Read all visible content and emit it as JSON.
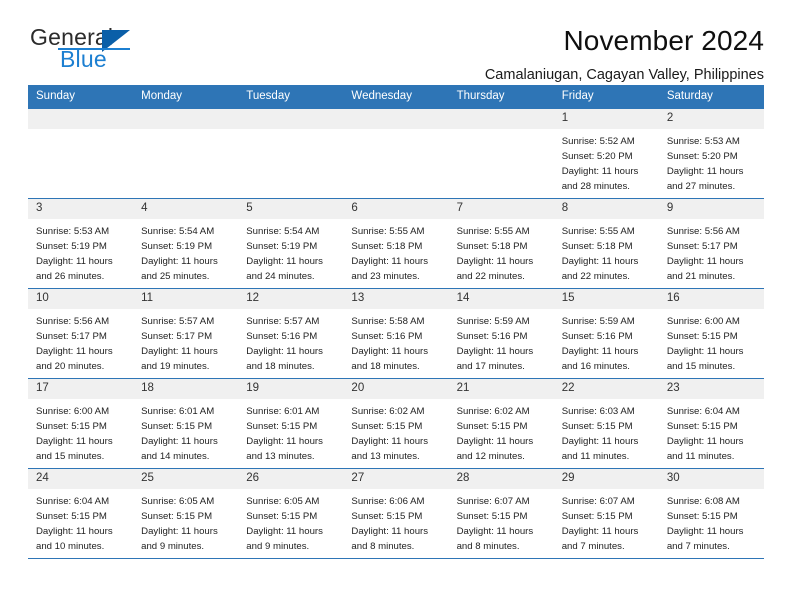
{
  "logo": {
    "word_top": "General",
    "word_bottom": "Blue",
    "triangle_icon": "blue-triangle-icon",
    "accent_dark": "#0a5fa8",
    "accent_light": "#1c7fd1"
  },
  "header": {
    "title": "November 2024",
    "location": "Camalaniugan, Cagayan Valley, Philippines"
  },
  "theme": {
    "header_blue": "#2e75b6",
    "daynum_gray": "#f0f0f0"
  },
  "weekdays": [
    "Sunday",
    "Monday",
    "Tuesday",
    "Wednesday",
    "Thursday",
    "Friday",
    "Saturday"
  ],
  "weeks": [
    [
      {
        "day": "",
        "lines": []
      },
      {
        "day": "",
        "lines": []
      },
      {
        "day": "",
        "lines": []
      },
      {
        "day": "",
        "lines": []
      },
      {
        "day": "",
        "lines": []
      },
      {
        "day": "1",
        "lines": [
          "Sunrise: 5:52 AM",
          "Sunset: 5:20 PM",
          "Daylight: 11 hours",
          "and 28 minutes."
        ]
      },
      {
        "day": "2",
        "lines": [
          "Sunrise: 5:53 AM",
          "Sunset: 5:20 PM",
          "Daylight: 11 hours",
          "and 27 minutes."
        ]
      }
    ],
    [
      {
        "day": "3",
        "lines": [
          "Sunrise: 5:53 AM",
          "Sunset: 5:19 PM",
          "Daylight: 11 hours",
          "and 26 minutes."
        ]
      },
      {
        "day": "4",
        "lines": [
          "Sunrise: 5:54 AM",
          "Sunset: 5:19 PM",
          "Daylight: 11 hours",
          "and 25 minutes."
        ]
      },
      {
        "day": "5",
        "lines": [
          "Sunrise: 5:54 AM",
          "Sunset: 5:19 PM",
          "Daylight: 11 hours",
          "and 24 minutes."
        ]
      },
      {
        "day": "6",
        "lines": [
          "Sunrise: 5:55 AM",
          "Sunset: 5:18 PM",
          "Daylight: 11 hours",
          "and 23 minutes."
        ]
      },
      {
        "day": "7",
        "lines": [
          "Sunrise: 5:55 AM",
          "Sunset: 5:18 PM",
          "Daylight: 11 hours",
          "and 22 minutes."
        ]
      },
      {
        "day": "8",
        "lines": [
          "Sunrise: 5:55 AM",
          "Sunset: 5:18 PM",
          "Daylight: 11 hours",
          "and 22 minutes."
        ]
      },
      {
        "day": "9",
        "lines": [
          "Sunrise: 5:56 AM",
          "Sunset: 5:17 PM",
          "Daylight: 11 hours",
          "and 21 minutes."
        ]
      }
    ],
    [
      {
        "day": "10",
        "lines": [
          "Sunrise: 5:56 AM",
          "Sunset: 5:17 PM",
          "Daylight: 11 hours",
          "and 20 minutes."
        ]
      },
      {
        "day": "11",
        "lines": [
          "Sunrise: 5:57 AM",
          "Sunset: 5:17 PM",
          "Daylight: 11 hours",
          "and 19 minutes."
        ]
      },
      {
        "day": "12",
        "lines": [
          "Sunrise: 5:57 AM",
          "Sunset: 5:16 PM",
          "Daylight: 11 hours",
          "and 18 minutes."
        ]
      },
      {
        "day": "13",
        "lines": [
          "Sunrise: 5:58 AM",
          "Sunset: 5:16 PM",
          "Daylight: 11 hours",
          "and 18 minutes."
        ]
      },
      {
        "day": "14",
        "lines": [
          "Sunrise: 5:59 AM",
          "Sunset: 5:16 PM",
          "Daylight: 11 hours",
          "and 17 minutes."
        ]
      },
      {
        "day": "15",
        "lines": [
          "Sunrise: 5:59 AM",
          "Sunset: 5:16 PM",
          "Daylight: 11 hours",
          "and 16 minutes."
        ]
      },
      {
        "day": "16",
        "lines": [
          "Sunrise: 6:00 AM",
          "Sunset: 5:15 PM",
          "Daylight: 11 hours",
          "and 15 minutes."
        ]
      }
    ],
    [
      {
        "day": "17",
        "lines": [
          "Sunrise: 6:00 AM",
          "Sunset: 5:15 PM",
          "Daylight: 11 hours",
          "and 15 minutes."
        ]
      },
      {
        "day": "18",
        "lines": [
          "Sunrise: 6:01 AM",
          "Sunset: 5:15 PM",
          "Daylight: 11 hours",
          "and 14 minutes."
        ]
      },
      {
        "day": "19",
        "lines": [
          "Sunrise: 6:01 AM",
          "Sunset: 5:15 PM",
          "Daylight: 11 hours",
          "and 13 minutes."
        ]
      },
      {
        "day": "20",
        "lines": [
          "Sunrise: 6:02 AM",
          "Sunset: 5:15 PM",
          "Daylight: 11 hours",
          "and 13 minutes."
        ]
      },
      {
        "day": "21",
        "lines": [
          "Sunrise: 6:02 AM",
          "Sunset: 5:15 PM",
          "Daylight: 11 hours",
          "and 12 minutes."
        ]
      },
      {
        "day": "22",
        "lines": [
          "Sunrise: 6:03 AM",
          "Sunset: 5:15 PM",
          "Daylight: 11 hours",
          "and 11 minutes."
        ]
      },
      {
        "day": "23",
        "lines": [
          "Sunrise: 6:04 AM",
          "Sunset: 5:15 PM",
          "Daylight: 11 hours",
          "and 11 minutes."
        ]
      }
    ],
    [
      {
        "day": "24",
        "lines": [
          "Sunrise: 6:04 AM",
          "Sunset: 5:15 PM",
          "Daylight: 11 hours",
          "and 10 minutes."
        ]
      },
      {
        "day": "25",
        "lines": [
          "Sunrise: 6:05 AM",
          "Sunset: 5:15 PM",
          "Daylight: 11 hours",
          "and 9 minutes."
        ]
      },
      {
        "day": "26",
        "lines": [
          "Sunrise: 6:05 AM",
          "Sunset: 5:15 PM",
          "Daylight: 11 hours",
          "and 9 minutes."
        ]
      },
      {
        "day": "27",
        "lines": [
          "Sunrise: 6:06 AM",
          "Sunset: 5:15 PM",
          "Daylight: 11 hours",
          "and 8 minutes."
        ]
      },
      {
        "day": "28",
        "lines": [
          "Sunrise: 6:07 AM",
          "Sunset: 5:15 PM",
          "Daylight: 11 hours",
          "and 8 minutes."
        ]
      },
      {
        "day": "29",
        "lines": [
          "Sunrise: 6:07 AM",
          "Sunset: 5:15 PM",
          "Daylight: 11 hours",
          "and 7 minutes."
        ]
      },
      {
        "day": "30",
        "lines": [
          "Sunrise: 6:08 AM",
          "Sunset: 5:15 PM",
          "Daylight: 11 hours",
          "and 7 minutes."
        ]
      }
    ]
  ]
}
